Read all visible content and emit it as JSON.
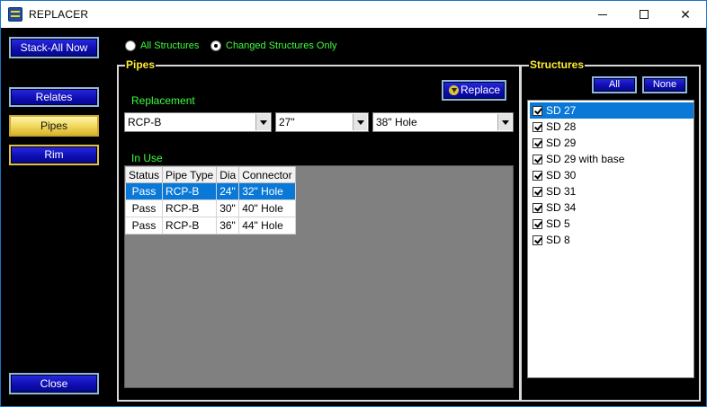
{
  "window": {
    "title": "REPLACER",
    "minimize_glyph": "",
    "maximize_glyph": "",
    "close_glyph": "✕"
  },
  "sidebar": {
    "stack_all": "Stack-All Now",
    "relates": "Relates",
    "pipes": "Pipes",
    "rim": "Rim",
    "close": "Close"
  },
  "filter": {
    "all_structures": "All Structures",
    "changed_only": "Changed Structures Only",
    "selected": "changed_only"
  },
  "pipes": {
    "group_title": "Pipes",
    "replacement_label": "Replacement",
    "replace_button": "Replace",
    "type_value": "RCP-B",
    "diameter_value": "27\"",
    "connector_value": "38\" Hole",
    "in_use_label": "In Use",
    "columns": [
      "Status",
      "Pipe Type",
      "Dia",
      "Connector"
    ],
    "rows": [
      {
        "status": "Pass",
        "type": "RCP-B",
        "dia": "24\"",
        "connector": "32\" Hole",
        "selected": true
      },
      {
        "status": "Pass",
        "type": "RCP-B",
        "dia": "30\"",
        "connector": "40\" Hole",
        "selected": false
      },
      {
        "status": "Pass",
        "type": "RCP-B",
        "dia": "36\"",
        "connector": "44\" Hole",
        "selected": false
      }
    ]
  },
  "structures": {
    "group_title": "Structures",
    "all_button": "All",
    "none_button": "None",
    "items": [
      {
        "label": "SD 27",
        "checked": true,
        "selected": true
      },
      {
        "label": "SD 28",
        "checked": true,
        "selected": false
      },
      {
        "label": "SD 29",
        "checked": true,
        "selected": false
      },
      {
        "label": "SD 29 with base",
        "checked": true,
        "selected": false
      },
      {
        "label": "SD 30",
        "checked": true,
        "selected": false
      },
      {
        "label": "SD 31",
        "checked": true,
        "selected": false
      },
      {
        "label": "SD 34",
        "checked": true,
        "selected": false
      },
      {
        "label": "SD 5",
        "checked": true,
        "selected": false
      },
      {
        "label": "SD 8",
        "checked": true,
        "selected": false
      }
    ]
  },
  "colors": {
    "accent_green": "#3cff3c",
    "title_yellow": "#ffee33",
    "selection_blue": "#0a78d7"
  }
}
